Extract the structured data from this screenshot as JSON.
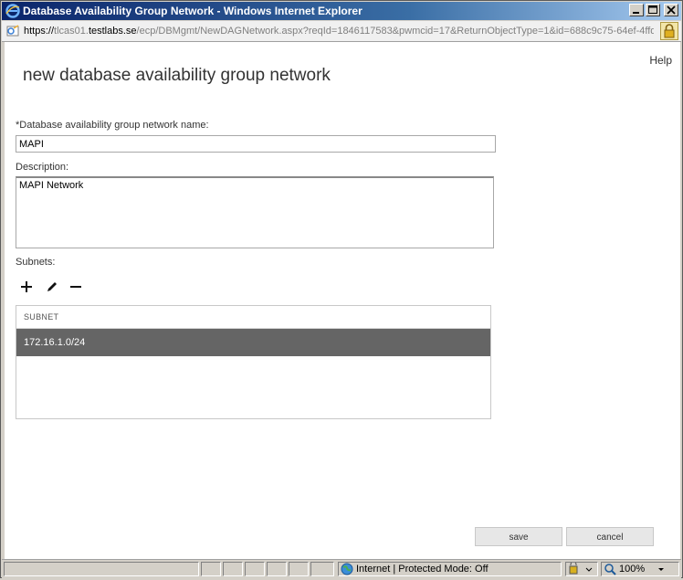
{
  "window": {
    "title": "Database Availability Group Network - Windows Internet Explorer"
  },
  "address_bar": {
    "scheme": "https://",
    "host_prefix": "tlcas01.",
    "host_main": "testlabs.se",
    "path": "/ecp/DBMgmt/NewDAGNetwork.aspx?reqId=1846117583&pwmcid=17&ReturnObjectType=1&id=688c9c75-64ef-4ffd-"
  },
  "page": {
    "help_label": "Help",
    "title": "new database availability group network"
  },
  "form": {
    "name_label": "*Database availability group network name:",
    "name_value": "MAPI",
    "description_label": "Description:",
    "description_value": "MAPI Network",
    "subnets_label": "Subnets:"
  },
  "subnets_table": {
    "header": "SUBNET",
    "rows": [
      "172.16.1.0/24"
    ]
  },
  "buttons": {
    "save": "save",
    "cancel": "cancel"
  },
  "status_bar": {
    "zone_text": "Internet | Protected Mode: Off",
    "zoom": "100%"
  },
  "colors": {
    "selected_row": "#656565",
    "title_bar": "#0a246a"
  }
}
